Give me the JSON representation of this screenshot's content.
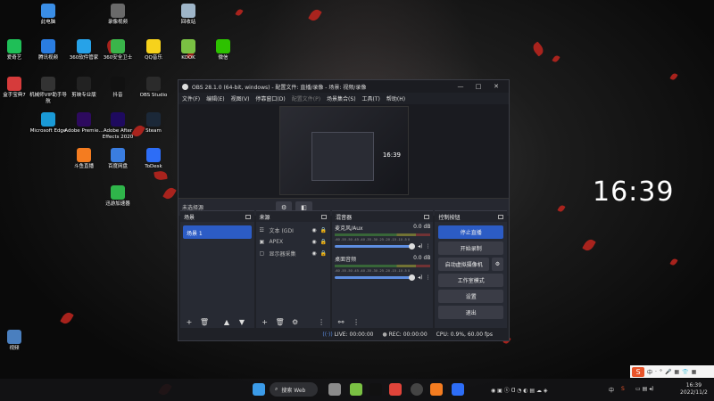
{
  "desktop": {
    "icons": [
      {
        "label": "此电脑",
        "color": "#3a8ee6"
      },
      {
        "label": "录像视频",
        "color": "#6a6a6a"
      },
      {
        "label": "回收站",
        "color": "#9fb6c9"
      },
      {
        "label": "爱奇艺",
        "color": "#1fbf57"
      },
      {
        "label": "腾讯视频",
        "color": "#2a7de1"
      },
      {
        "label": "360软件管家",
        "color": "#27a2e8"
      },
      {
        "label": "360安全卫士",
        "color": "#3ab54a"
      },
      {
        "label": "QQ音乐",
        "color": "#f6d21c"
      },
      {
        "label": "KOOK",
        "color": "#7ac143"
      },
      {
        "label": "微信",
        "color": "#2dc100"
      },
      {
        "label": "盒手宝典7",
        "color": "#d63b3b"
      },
      {
        "label": "机械师VIP助手导航",
        "color": "#333333"
      },
      {
        "label": "剪映专业版",
        "color": "#222222"
      },
      {
        "label": "抖音",
        "color": "#111111"
      },
      {
        "label": "OBS Studio",
        "color": "#2b2b2b"
      },
      {
        "label": "Microsoft Edge",
        "color": "#1a9ad6"
      },
      {
        "label": "Adobe Premie...",
        "color": "#2d0a5e"
      },
      {
        "label": "Adobe After Effects 2020",
        "color": "#1e0a5e"
      },
      {
        "label": "Steam",
        "color": "#1b2838"
      },
      {
        "label": "斗鱼直播",
        "color": "#f47c20"
      },
      {
        "label": "百度网盘",
        "color": "#3a7de0"
      },
      {
        "label": "ToDesk",
        "color": "#2d6df6"
      },
      {
        "label": "迅游加速器",
        "color": "#2fb54a"
      },
      {
        "label": "视频",
        "color": "#4a7fbf"
      }
    ],
    "clock": "16:39"
  },
  "obs": {
    "title": "OBS 28.1.0 (64-bit, windows) - 配置文件: 直播/录像 - 场景: 视频/录像",
    "window_buttons": [
      "—",
      "□",
      "✕"
    ],
    "menu": [
      "文件(F)",
      "编辑(E)",
      "视图(V)",
      "停靠窗口(D)",
      "配置文件(P)",
      "场景集合(S)",
      "工具(T)",
      "帮助(H)"
    ],
    "preview_time": "16:39",
    "source_bar": {
      "text": "未选择源",
      "gear": "⚙",
      "filter": "◧"
    },
    "scenes": {
      "header": "场景",
      "items": [
        "场景 1"
      ]
    },
    "sources": {
      "header": "来源",
      "items": [
        {
          "icon": "☲",
          "name": "文本 (GDI",
          "eye": "◉",
          "lock": "🔒"
        },
        {
          "icon": "▣",
          "name": "APEX",
          "eye": "◉",
          "lock": "🔒"
        },
        {
          "icon": "▢",
          "name": "显示器采集",
          "eye": "◉",
          "lock": "🔒"
        }
      ]
    },
    "mixer": {
      "header": "混音器",
      "ticks": "-60 -55 -50 -45 -40 -35 -30 -25 -20 -15 -10 -5 0",
      "channels": [
        {
          "name": "麦克风/Aux",
          "db": "0.0 dB",
          "level": 0.98
        },
        {
          "name": "桌面音频",
          "db": "0.0 dB",
          "level": 0.98
        }
      ]
    },
    "controls": {
      "header": "控制按钮",
      "buttons": [
        "停止直播",
        "开始录制",
        "启动虚拟摄像机",
        "工作室模式",
        "设置",
        "退出"
      ]
    },
    "status": {
      "live": "LIVE: 00:00:00",
      "rec": "REC: 00:00:00",
      "cpu": "CPU: 0.9%, 60.00 fps"
    }
  },
  "taskbar": {
    "search": "搜索 Web",
    "lang": "中",
    "time": "16:39",
    "date": "2022/11/2"
  },
  "ime": {
    "logo": "S",
    "items": [
      "中",
      "·",
      "°",
      "🎤",
      "▦",
      "👕",
      "▦"
    ]
  }
}
